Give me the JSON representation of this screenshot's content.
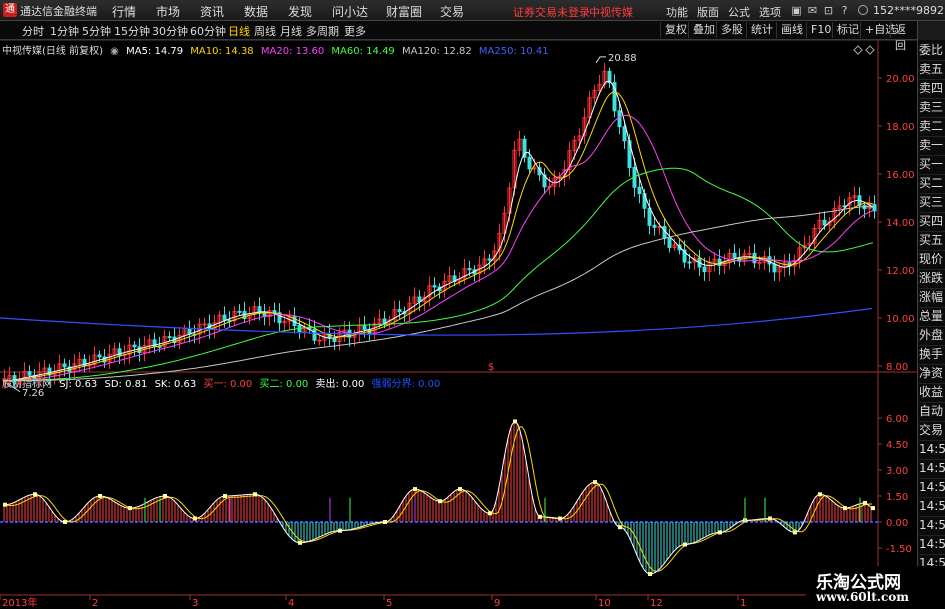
{
  "app": {
    "title": "通达信金融终端",
    "menus": [
      "行情",
      "市场",
      "资讯",
      "数据",
      "发现",
      "问小达",
      "财富圈",
      "交易"
    ],
    "trade_status": "证券交易未登录",
    "stock_name": "中视传媒",
    "right_menus": [
      "功能",
      "版面",
      "公式",
      "选项"
    ],
    "user": "152****9892"
  },
  "toolbar": {
    "periods": [
      "分时",
      "1分钟",
      "5分钟",
      "15分钟",
      "30分钟",
      "60分钟",
      "日线",
      "周线",
      "月线",
      "多周期",
      "更多"
    ],
    "active_period": "日线",
    "buttons": [
      "复权",
      "叠加",
      "多股",
      "统计",
      "画线",
      "F10",
      "标记",
      "+自选",
      "返回"
    ]
  },
  "right_panel": {
    "items": [
      "委比",
      "卖五",
      "卖四",
      "卖三",
      "卖二",
      "卖一",
      "买一",
      "买二",
      "买三",
      "买四",
      "买五",
      "现价",
      "涨跌",
      "涨幅",
      "总量",
      "外盘",
      "换手",
      "净资",
      "收益",
      "自动",
      "交易",
      "14:56",
      "14:56",
      "14:56",
      "14:56",
      "14:56",
      "14:56",
      "14:56",
      "14:56"
    ]
  },
  "main_legend": {
    "title": "中视传媒(日线 前复权)",
    "ma": [
      {
        "label": "MA5: 14.79",
        "color": "#ffffff"
      },
      {
        "label": "MA10: 14.38",
        "color": "#ffd700"
      },
      {
        "label": "MA20: 13.60",
        "color": "#ff40ff"
      },
      {
        "label": "MA60: 14.49",
        "color": "#40ff40"
      },
      {
        "label": "MA120: 12.82",
        "color": "#c8c8c8"
      },
      {
        "label": "MA250: 10.41",
        "color": "#4060ff"
      }
    ]
  },
  "sub_legend": {
    "title": "股朋指标网",
    "items": [
      {
        "label": "SJ: 0.63",
        "color": "#ffffff"
      },
      {
        "label": "SD: 0.81",
        "color": "#ffffff"
      },
      {
        "label": "SK: 0.63",
        "color": "#ffffff"
      },
      {
        "label": "买一: 0.00",
        "color": "#ff4040"
      },
      {
        "label": "买二: 0.00",
        "color": "#40ff40"
      },
      {
        "label": "卖出: 0.00",
        "color": "#ffffff"
      },
      {
        "label": "强弱分界: 0.00",
        "color": "#2050ff"
      }
    ]
  },
  "price_axis": [
    "20.00",
    "18.00",
    "16.00",
    "14.00",
    "12.00",
    "10.00",
    "8.00"
  ],
  "osc_axis": [
    "6.00",
    "4.50",
    "3.00",
    "1.50",
    "0.00",
    "-1.50"
  ],
  "annotations": {
    "high": "20.88",
    "low": "7.26",
    "marker": "$"
  },
  "time_axis": [
    "2013年",
    "2",
    "3",
    "4",
    "5",
    "9",
    "10",
    "12",
    "1"
  ],
  "footer": {
    "brand": "乐淘公式网",
    "url": "www.60lt.com"
  }
}
